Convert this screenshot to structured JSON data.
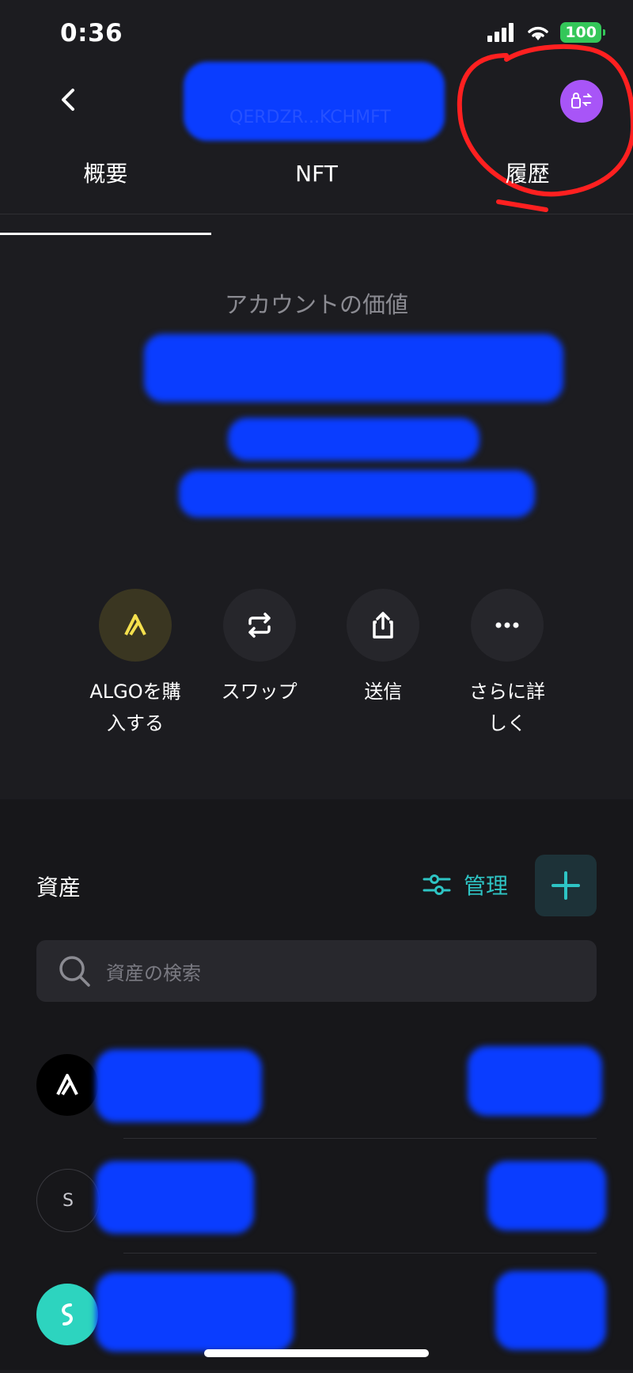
{
  "status_bar": {
    "time": "0:36",
    "battery": "100"
  },
  "header": {
    "title_masked": "QERDZR...KCHMFT"
  },
  "tabs": [
    {
      "label": "概要",
      "active": true
    },
    {
      "label": "NFT",
      "active": false
    },
    {
      "label": "履歴",
      "active": false
    }
  ],
  "account": {
    "value_label": "アカウントの価値"
  },
  "actions": [
    {
      "label": "ALGOを購入する",
      "icon": "algo-icon"
    },
    {
      "label": "スワップ",
      "icon": "swap-icon"
    },
    {
      "label": "送信",
      "icon": "share-icon"
    },
    {
      "label": "さらに詳しく",
      "icon": "more-icon"
    }
  ],
  "assets": {
    "title": "資産",
    "manage_label": "管理",
    "search_placeholder": "資産の検索",
    "rows": [
      {
        "icon": "algo-icon"
      },
      {
        "icon": "letter-s-icon",
        "letter": "S"
      },
      {
        "icon": "teal-token-icon"
      }
    ]
  },
  "colors": {
    "accent": "#2ec4c4",
    "avatar": "#a855f7",
    "redaction": "#0a3dff",
    "annotation": "#ff2020"
  }
}
